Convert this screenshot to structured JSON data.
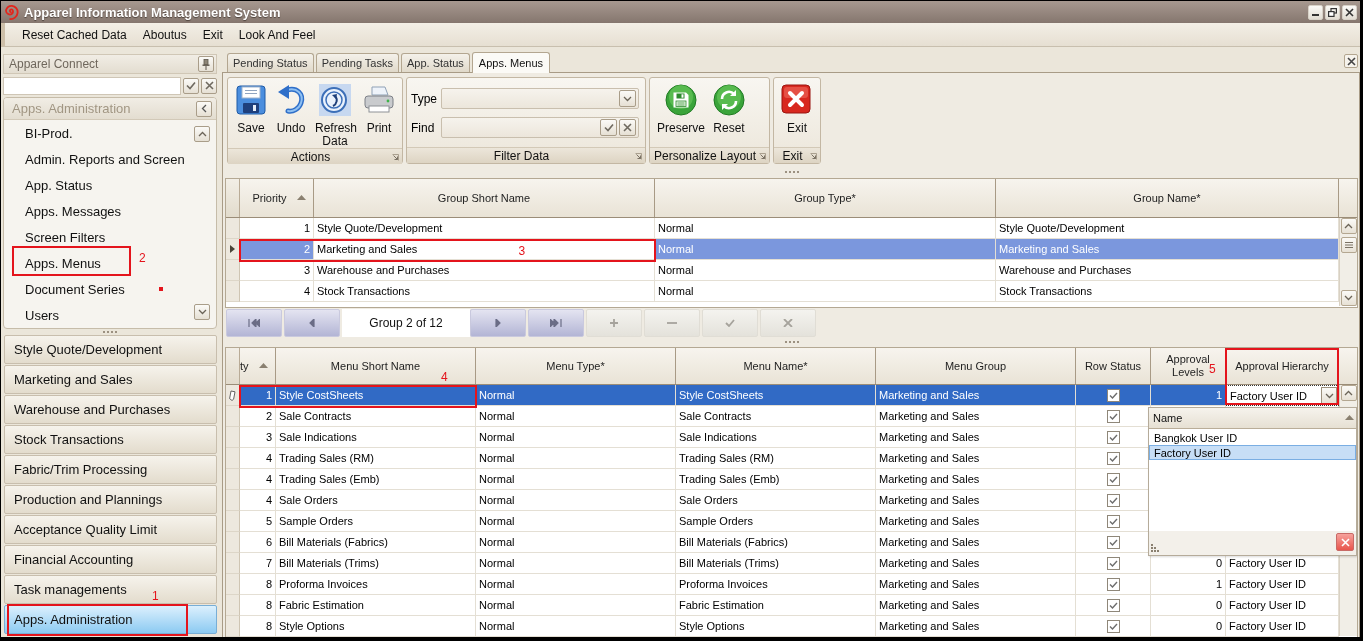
{
  "window": {
    "title": "Apparel Information Management System"
  },
  "menu_bar": [
    {
      "label": "Reset Cached Data"
    },
    {
      "label": "Aboutus"
    },
    {
      "label": "Exit"
    },
    {
      "label": "Look And Feel"
    }
  ],
  "sidebar": {
    "title": "Apparel Connect",
    "group_panel": {
      "title": "Apps. Administration",
      "items": [
        {
          "label": "BI-Prod.",
          "selected": false
        },
        {
          "label": "Admin. Reports and Screen",
          "selected": false
        },
        {
          "label": "App. Status",
          "selected": false
        },
        {
          "label": "Apps. Messages",
          "selected": false
        },
        {
          "label": "Screen Filters",
          "selected": false
        },
        {
          "label": "Apps. Menus",
          "selected": false,
          "callout": "2"
        },
        {
          "label": "Document Series",
          "selected": false,
          "dot": true
        },
        {
          "label": "Users",
          "selected": false
        }
      ]
    },
    "nav_groups": [
      {
        "label": "Style Quote/Development",
        "selected": false
      },
      {
        "label": "Marketing and Sales",
        "selected": false
      },
      {
        "label": "Warehouse and Purchases",
        "selected": false
      },
      {
        "label": "Stock Transactions",
        "selected": false
      },
      {
        "label": "Fabric/Trim Processing",
        "selected": false
      },
      {
        "label": "Production and Plannings",
        "selected": false
      },
      {
        "label": "Acceptance Quality Limit",
        "selected": false
      },
      {
        "label": "Financial Accounting",
        "selected": false
      },
      {
        "label": "Task managements",
        "selected": false
      },
      {
        "label": "Apps. Administration",
        "selected": true,
        "callout": "1"
      }
    ]
  },
  "document_tabs": [
    {
      "label": "Pending Status",
      "selected": false
    },
    {
      "label": "Pending Tasks",
      "selected": false
    },
    {
      "label": "App. Status",
      "selected": false
    },
    {
      "label": "Apps. Menus",
      "selected": true
    }
  ],
  "ribbon": {
    "groups": [
      {
        "caption": "Actions",
        "buttons": [
          {
            "label": "Save",
            "kind": "save"
          },
          {
            "label": "Undo",
            "kind": "undo"
          },
          {
            "label": "Refresh Data",
            "kind": "refresh"
          },
          {
            "label": "Print",
            "kind": "print"
          }
        ]
      },
      {
        "caption": "Filter Data",
        "fields": [
          {
            "label": "Type",
            "kind": "combo"
          },
          {
            "label": "Find",
            "kind": "search"
          }
        ]
      },
      {
        "caption": "Personalize Layout",
        "buttons": [
          {
            "label": "Preserve",
            "kind": "preserve"
          },
          {
            "label": "Reset",
            "kind": "reset"
          }
        ]
      },
      {
        "caption": "Exit",
        "buttons": [
          {
            "label": "Exit",
            "kind": "exit"
          }
        ]
      }
    ]
  },
  "groups_grid": {
    "editing": false,
    "columns": [
      {
        "label": "Priority",
        "kind": "number",
        "sorted": true,
        "focused": false
      },
      {
        "label": "Group Short Name",
        "kind": "text",
        "sorted": false,
        "focused": true
      },
      {
        "label": "Group Type*",
        "kind": "text",
        "sorted": false,
        "focused": false
      },
      {
        "label": "Group Name*",
        "kind": "text",
        "sorted": false,
        "focused": false
      }
    ],
    "rows": [
      {
        "selected": false,
        "cells": [
          "1",
          "Style Quote/Development",
          "Normal",
          "Style Quote/Development"
        ]
      },
      {
        "selected": true,
        "cells": [
          "2",
          "Marketing and Sales",
          "Normal",
          "Marketing and Sales"
        ],
        "callout": "3"
      },
      {
        "selected": false,
        "cells": [
          "3",
          "Warehouse and Purchases",
          "Normal",
          "Warehouse and Purchases"
        ]
      },
      {
        "selected": false,
        "cells": [
          "4",
          "Stock Transactions",
          "Normal",
          "Stock Transactions"
        ]
      }
    ]
  },
  "navigator": {
    "buttons_before": [
      {
        "kind": "first",
        "disabled": false
      },
      {
        "kind": "previous",
        "disabled": false
      }
    ],
    "position": "Group 2 of 12",
    "buttons_after": [
      {
        "kind": "next",
        "disabled": false
      },
      {
        "kind": "last",
        "disabled": false
      },
      {
        "kind": "add",
        "disabled": true
      },
      {
        "kind": "remove",
        "disabled": true
      },
      {
        "kind": "confirm",
        "disabled": true
      },
      {
        "kind": "cancel",
        "disabled": true
      }
    ]
  },
  "menus_grid": {
    "editing": true,
    "columns": [
      {
        "label": "ty",
        "kind": "number",
        "sorted": true,
        "cut": true,
        "focused": false
      },
      {
        "label": "Menu Short Name",
        "kind": "text",
        "sorted": false,
        "focused": false
      },
      {
        "label": "Menu Type*",
        "kind": "text",
        "sorted": false,
        "focused": false
      },
      {
        "label": "Menu Name*",
        "kind": "text",
        "sorted": false,
        "focused": false
      },
      {
        "label": "Menu Group",
        "kind": "text",
        "sorted": false,
        "focused": false
      },
      {
        "label": "Row Status",
        "kind": "check",
        "sorted": false,
        "focused": false
      },
      {
        "label": "Approval Levels",
        "kind": "number",
        "sorted": false,
        "focused": false
      },
      {
        "label": "Approval Hierarchy",
        "kind": "lookup",
        "sorted": false,
        "focused": true,
        "callout": "5"
      }
    ],
    "rows": [
      {
        "selected": true,
        "cells": [
          "1",
          "Style CostSheets",
          "Normal",
          "Style CostSheets",
          "Marketing and Sales",
          {
            "checked": true
          },
          "1",
          "Factory User ID"
        ],
        "callout": "4"
      },
      {
        "selected": false,
        "cells": [
          "2",
          "Sale Contracts",
          "Normal",
          "Sale Contracts",
          "Marketing and Sales",
          {
            "checked": true
          },
          null,
          null
        ]
      },
      {
        "selected": false,
        "cells": [
          "3",
          "Sale Indications",
          "Normal",
          "Sale Indications",
          "Marketing and Sales",
          {
            "checked": true
          },
          null,
          null
        ]
      },
      {
        "selected": false,
        "cells": [
          "4",
          "Trading Sales (RM)",
          "Normal",
          "Trading Sales (RM)",
          "Marketing and Sales",
          {
            "checked": true
          },
          null,
          null
        ]
      },
      {
        "selected": false,
        "cells": [
          "4",
          "Trading Sales (Emb)",
          "Normal",
          "Trading Sales (Emb)",
          "Marketing and Sales",
          {
            "checked": true
          },
          null,
          null
        ]
      },
      {
        "selected": false,
        "cells": [
          "4",
          "Sale Orders",
          "Normal",
          "Sale Orders",
          "Marketing and Sales",
          {
            "checked": true
          },
          null,
          null
        ]
      },
      {
        "selected": false,
        "cells": [
          "5",
          "Sample Orders",
          "Normal",
          "Sample Orders",
          "Marketing and Sales",
          {
            "checked": true
          },
          null,
          null
        ]
      },
      {
        "selected": false,
        "cells": [
          "6",
          "Bill Materials (Fabrics)",
          "Normal",
          "Bill Materials (Fabrics)",
          "Marketing and Sales",
          {
            "checked": true
          },
          null,
          null
        ]
      },
      {
        "selected": false,
        "cells": [
          "7",
          "Bill Materials (Trims)",
          "Normal",
          "Bill Materials (Trims)",
          "Marketing and Sales",
          {
            "checked": true
          },
          "0",
          "Factory User ID"
        ]
      },
      {
        "selected": false,
        "cells": [
          "8",
          "Proforma Invoices",
          "Normal",
          "Proforma Invoices",
          "Marketing and Sales",
          {
            "checked": true
          },
          "1",
          "Factory User ID"
        ]
      },
      {
        "selected": false,
        "cells": [
          "8",
          "Fabric Estimation",
          "Normal",
          "Fabric Estimation",
          "Marketing and Sales",
          {
            "checked": true
          },
          "0",
          "Factory User ID"
        ]
      },
      {
        "selected": false,
        "cells": [
          "8",
          "Style Options",
          "Normal",
          "Style Options",
          "Marketing and Sales",
          {
            "checked": true
          },
          "0",
          "Factory User ID"
        ]
      }
    ],
    "dropdown": {
      "column": "Name",
      "sorted": true,
      "items": [
        {
          "label": "Bangkok User ID",
          "selected": false
        },
        {
          "label": "Factory User ID",
          "selected": true
        }
      ]
    }
  }
}
